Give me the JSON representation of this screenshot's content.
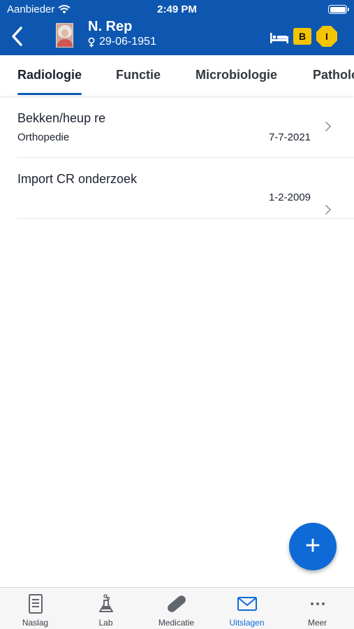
{
  "status_bar": {
    "carrier": "Aanbieder",
    "time": "2:49 PM"
  },
  "header": {
    "patient_name": "N. Rep",
    "dob": "29-06-1951",
    "badges": [
      "B",
      "I"
    ],
    "colors": {
      "bar": "#0e57b0",
      "badge_b": "#f4c400",
      "badge_i": "#f4c400"
    }
  },
  "tabs": [
    {
      "label": "Radiologie",
      "active": true
    },
    {
      "label": "Functie",
      "active": false
    },
    {
      "label": "Microbiologie",
      "active": false
    },
    {
      "label": "Pathologie",
      "active": false
    }
  ],
  "results": [
    {
      "title": "Bekken/heup re",
      "department": "Orthopedie",
      "date": "7-7-2021"
    },
    {
      "title": "Import CR onderzoek",
      "department": "",
      "date": "1-2-2009"
    }
  ],
  "fab": {
    "label": "+"
  },
  "bottom_nav": [
    {
      "label": "Naslag",
      "icon": "document-icon",
      "active": false
    },
    {
      "label": "Lab",
      "icon": "flask-icon",
      "active": false
    },
    {
      "label": "Medicatie",
      "icon": "pill-icon",
      "active": false
    },
    {
      "label": "Uitslagen",
      "icon": "envelope-icon",
      "active": true
    },
    {
      "label": "Meer",
      "icon": "more-icon",
      "active": false
    }
  ]
}
